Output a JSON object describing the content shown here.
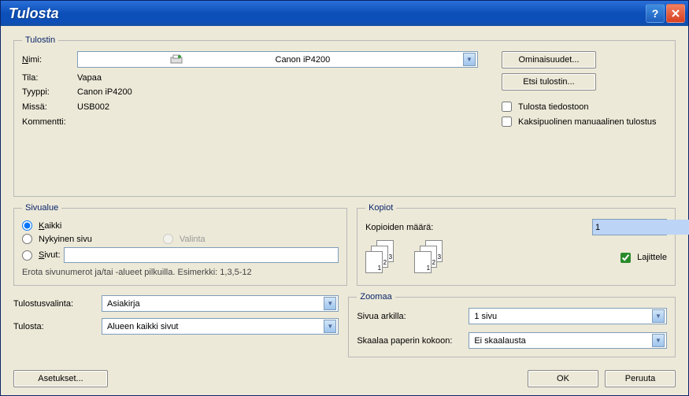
{
  "title": "Tulosta",
  "printer": {
    "legend": "Tulostin",
    "name_label": "Nimi:",
    "name_value": "Canon iP4200",
    "status_label": "Tila:",
    "status_value": "Vapaa",
    "type_label": "Tyyppi:",
    "type_value": "Canon iP4200",
    "where_label": "Missä:",
    "where_value": "USB002",
    "comment_label": "Kommentti:",
    "comment_value": "",
    "properties_btn": "Ominaisuudet...",
    "find_btn": "Etsi tulostin...",
    "to_file": "Tulosta tiedostoon",
    "duplex": "Kaksipuolinen manuaalinen tulostus"
  },
  "range": {
    "legend": "Sivualue",
    "all": "Kaikki",
    "current": "Nykyinen sivu",
    "selection": "Valinta",
    "pages": "Sivut:",
    "pages_value": "",
    "hint": "Erota sivunumerot ja/tai -alueet pilkuilla. Esimerkki: 1,3,5-12"
  },
  "copies": {
    "legend": "Kopiot",
    "count_label": "Kopioiden määrä:",
    "count_value": "1",
    "collate": "Lajittele",
    "stackA": [
      "3",
      "2",
      "1"
    ],
    "stackB": [
      "3",
      "2",
      "1"
    ]
  },
  "print_what": {
    "label": "Tulostusvalinta:",
    "value": "Asiakirja"
  },
  "print_side": {
    "label": "Tulosta:",
    "value": "Alueen kaikki sivut"
  },
  "zoom": {
    "legend": "Zoomaa",
    "per_sheet_label": "Sivua arkilla:",
    "per_sheet_value": "1 sivu",
    "scale_label": "Skaalaa paperin kokoon:",
    "scale_value": "Ei skaalausta"
  },
  "buttons": {
    "options": "Asetukset...",
    "ok": "OK",
    "cancel": "Peruuta"
  }
}
